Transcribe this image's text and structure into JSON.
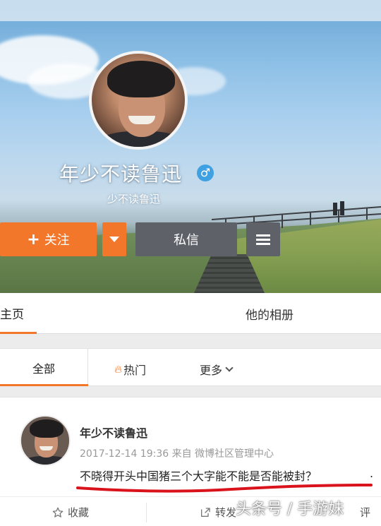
{
  "profile": {
    "name": "年少不读鲁迅",
    "gender_symbol": "♂",
    "subtitle": "少不读鲁迅"
  },
  "actions": {
    "follow_plus": "+",
    "follow_label": "关注",
    "message_label": "私信"
  },
  "tabs": {
    "home": "主页",
    "album": "他的相册"
  },
  "filters": {
    "all": "全部",
    "hot": "热门",
    "more": "更多"
  },
  "post": {
    "author": "年少不读鲁迅",
    "meta": "2017-12-14 19:36 来自 微博社区管理中心",
    "text": "不晓得开头中国猪三个大字能不能是否能被封？",
    "trailing_dot": ".",
    "favorite_label": "收藏",
    "repost_label": "转发",
    "comment_label": "评"
  },
  "watermark": "头条号 / 手游妹",
  "colors": {
    "accent_orange": "#f3772a",
    "button_gray": "#5e6168",
    "gender_blue": "#3fa1e2",
    "annotation_red": "#d9121b"
  },
  "icons": [
    "plus-icon",
    "chevron-down-icon",
    "menu-icon",
    "male-icon",
    "flame-icon",
    "star-icon",
    "share-icon"
  ]
}
